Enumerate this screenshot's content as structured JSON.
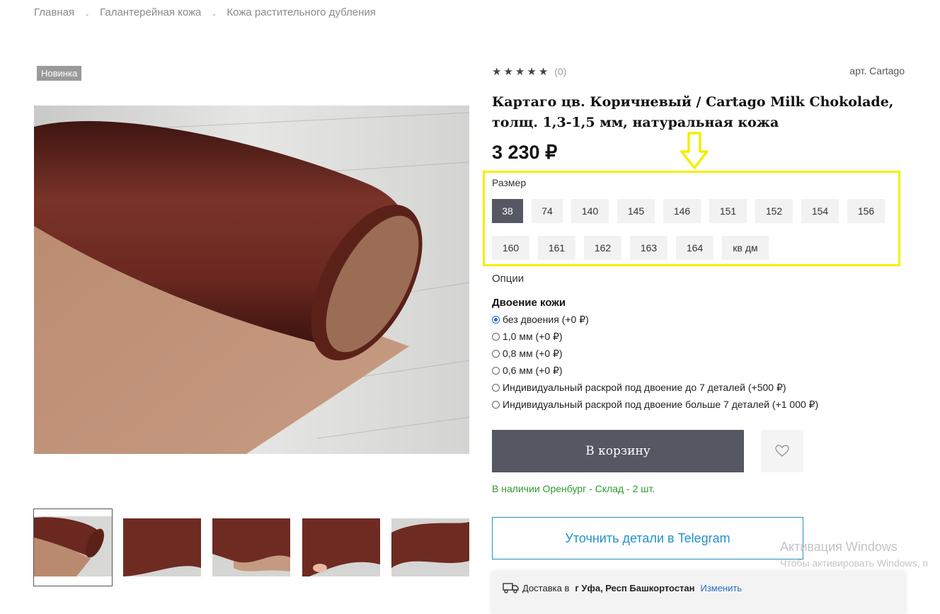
{
  "breadcrumbs": [
    "Главная",
    "Галантерейная кожа",
    "Кожа растительного дубления"
  ],
  "breadcrumb_separator": "-",
  "badge": "Новинка",
  "rating": {
    "stars": 5,
    "filled": 0,
    "count_text": "(0)"
  },
  "article": "арт. Cartago",
  "title": "Картаго цв. Коричневый / Cartago Milk Chokolade, толщ. 1,3-1,5 мм, натуральная кожа",
  "price": "3 230 ₽",
  "size": {
    "label": "Размер",
    "options": [
      "38",
      "74",
      "140",
      "145",
      "146",
      "151",
      "152",
      "154",
      "156",
      "160",
      "161",
      "162",
      "163",
      "164",
      "кв дм"
    ],
    "selected": "38"
  },
  "options_label": "Опции",
  "splitting": {
    "title": "Двоение кожи",
    "options": [
      "без двоения (+0 ₽)",
      "1,0 мм (+0 ₽)",
      "0,8 мм (+0 ₽)",
      "0,6 мм (+0 ₽)",
      "Индивидуальный раскрой под двоение до 7 деталей (+500 ₽)",
      "Индивидуальный раскрой под двоение больше 7 деталей (+1 000 ₽)"
    ],
    "selected_index": 0
  },
  "cart_button": "В корзину",
  "stock_text": "В наличии Оренбург - Склад - 2 шт.",
  "telegram_button": "Уточнить детали в Telegram",
  "delivery": {
    "label": "Доставка в",
    "city": "г Уфа, Респ Башкортостан",
    "change": "Изменить"
  },
  "windows_activation": {
    "title": "Активация Windows",
    "subtitle": "Чтобы активировать Windows, п"
  },
  "colors": {
    "accent_dark": "#555862",
    "highlight": "#f4ee00",
    "stock_green": "#2e9a2e",
    "telegram_blue": "#2590c8",
    "leather": "#6b2a22"
  },
  "icons": [
    "star-icon",
    "heart-icon",
    "truck-icon",
    "arrow-down-icon"
  ]
}
